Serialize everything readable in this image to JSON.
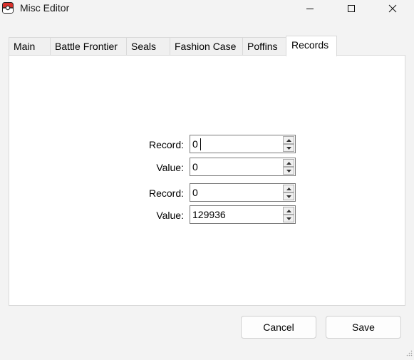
{
  "window": {
    "title": "Misc Editor",
    "controls": [
      "minimize-icon",
      "maximize-icon",
      "close-icon"
    ]
  },
  "tabs": [
    {
      "label": "Main",
      "active": false
    },
    {
      "label": "Battle Frontier",
      "active": false
    },
    {
      "label": "Seals",
      "active": false
    },
    {
      "label": "Fashion Case",
      "active": false
    },
    {
      "label": "Poffins",
      "active": false
    },
    {
      "label": "Records",
      "active": true
    }
  ],
  "records": {
    "fields": [
      {
        "label": "Record:",
        "value": "0"
      },
      {
        "label": "Value:",
        "value": "0"
      },
      {
        "label": "Record:",
        "value": "0"
      },
      {
        "label": "Value:",
        "value": "129936"
      }
    ]
  },
  "buttons": {
    "cancel": "Cancel",
    "save": "Save"
  },
  "colors": {
    "window_bg": "#f3f3f3",
    "panel_bg": "#ffffff",
    "icon_red": "#d9312b"
  }
}
